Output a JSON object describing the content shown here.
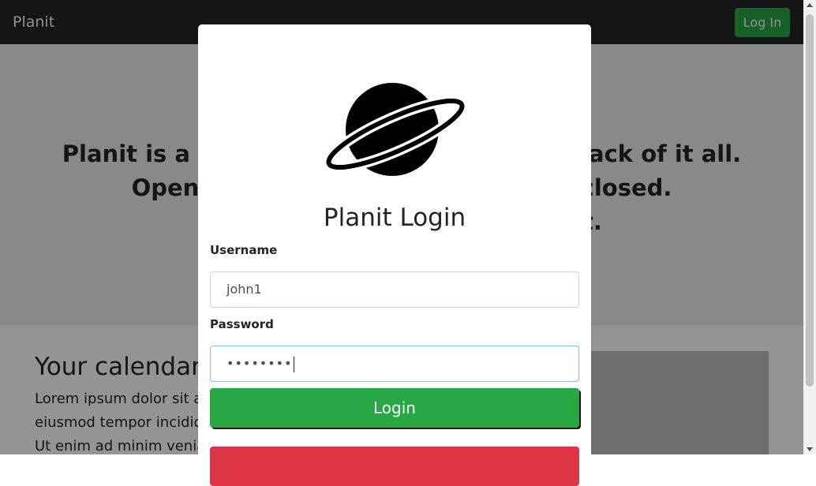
{
  "navbar": {
    "brand": "Planit",
    "login_label": "Log In",
    "login_color": "#28a745"
  },
  "hero": {
    "lines": [
      "Planit is a productivity tool that keeps track of it all.",
      "Open your calendar without being closed.",
      "Try something new with Planit."
    ]
  },
  "section": {
    "title": "Your calendar",
    "body": [
      "Lorem ipsum dolor sit amet, consectetur adipiscing elit, sed do",
      "eiusmod tempor incididunt ut labore et dolore magna aliqua.",
      "Ut enim ad minim veniam, quis nostrud exercitation."
    ]
  },
  "modal": {
    "logo_icon": "planet-icon",
    "title": "Planit Login",
    "username_label": "Username",
    "username_value": "john1",
    "password_label": "Password",
    "password_value": "••••••••",
    "login_button": "Login",
    "login_color": "#28a745",
    "secondary_button_color": "#dc3545"
  }
}
